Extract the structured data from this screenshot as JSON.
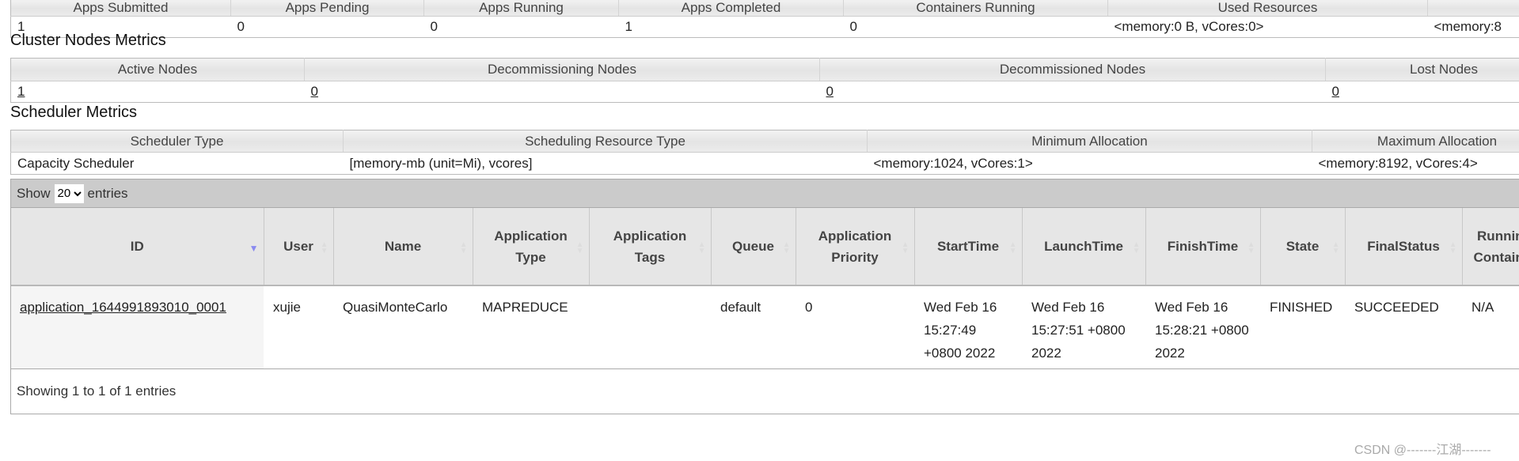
{
  "cluster_metrics": {
    "headers": [
      "Apps Submitted",
      "Apps Pending",
      "Apps Running",
      "Apps Completed",
      "Containers Running",
      "Used Resources",
      ""
    ],
    "values": [
      "1",
      "0",
      "0",
      "1",
      "0",
      "<memory:0 B, vCores:0>",
      "<memory:8"
    ]
  },
  "nodes": {
    "title": "Cluster Nodes Metrics",
    "headers": [
      "Active Nodes",
      "Decommissioning Nodes",
      "Decommissioned Nodes",
      "Lost Nodes"
    ],
    "values": [
      "1",
      "0",
      "0",
      "0"
    ]
  },
  "scheduler": {
    "title": "Scheduler Metrics",
    "headers": [
      "Scheduler Type",
      "Scheduling Resource Type",
      "Minimum Allocation",
      "Maximum Allocation"
    ],
    "values": [
      "Capacity Scheduler",
      "[memory-mb (unit=Mi), vcores]",
      "<memory:1024, vCores:1>",
      "<memory:8192, vCores:4>"
    ]
  },
  "apps": {
    "show_label": "Show",
    "entries_label": "entries",
    "page_size": "20",
    "columns": [
      "ID",
      "User",
      "Name",
      "Application Type",
      "Application Tags",
      "Queue",
      "Application Priority",
      "StartTime",
      "LaunchTime",
      "FinishTime",
      "State",
      "FinalStatus",
      "Running Containers"
    ],
    "rows": [
      [
        "application_1644991893010_0001",
        "xujie",
        "QuasiMonteCarlo",
        "MAPREDUCE",
        "",
        "default",
        "0",
        "Wed Feb 16 15:27:49 +0800 2022",
        "Wed Feb 16 15:27:51 +0800 2022",
        "Wed Feb 16 15:28:21 +0800 2022",
        "FINISHED",
        "SUCCEEDED",
        "N/A"
      ]
    ],
    "footer": "Showing 1 to 1 of 1 entries",
    "sort_color": "#8a8af0"
  },
  "watermark": "CSDN @-------江湖-------"
}
